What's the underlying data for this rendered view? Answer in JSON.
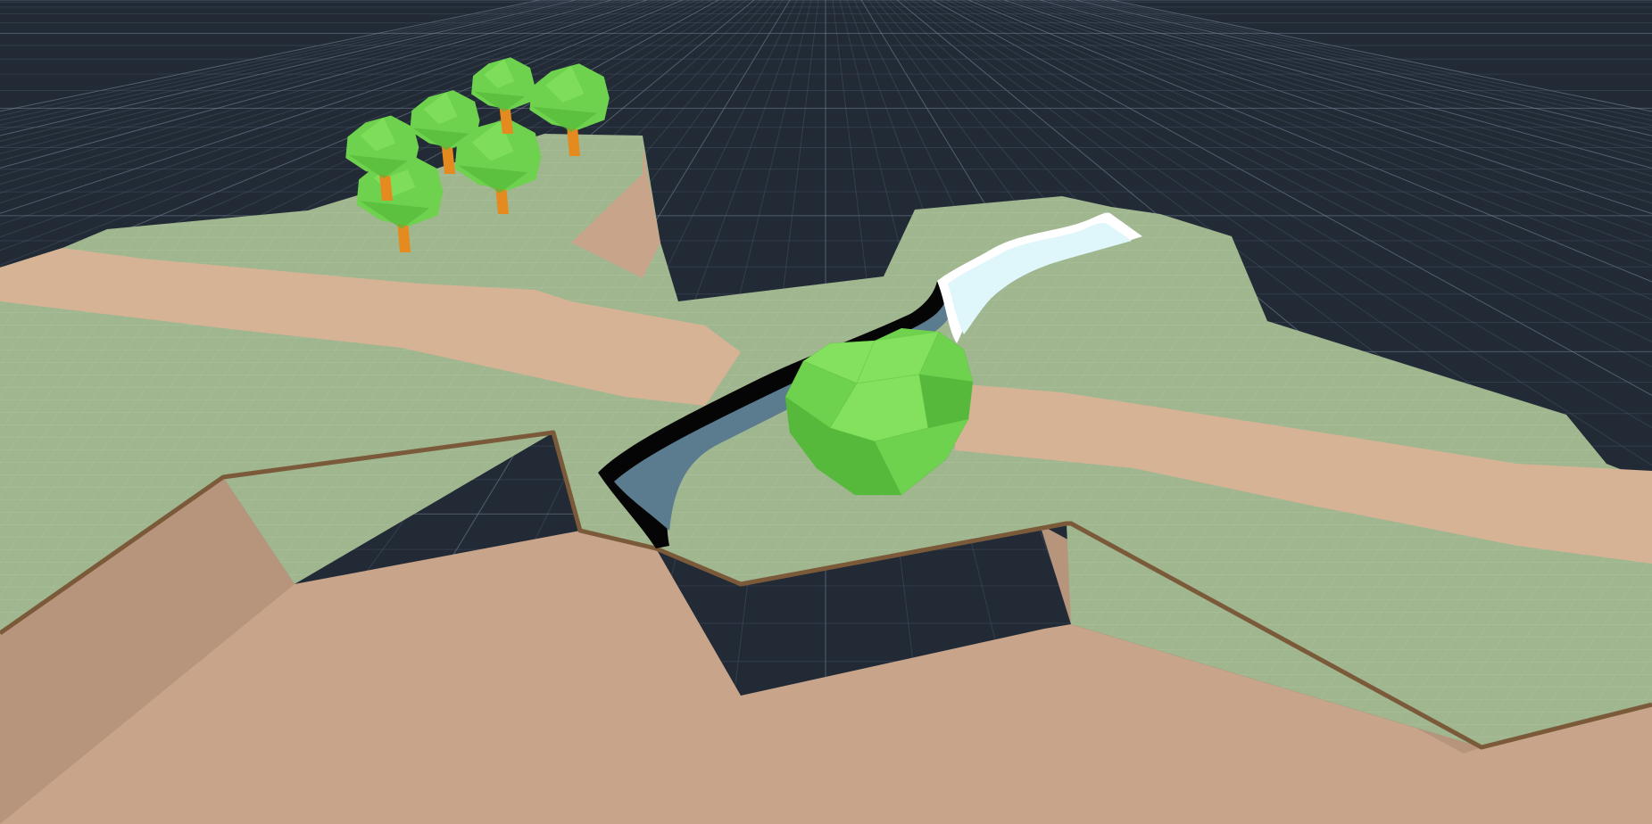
{
  "scene": {
    "kind": "3d-editor-viewport",
    "objects": [
      {
        "name": "terrain-tile",
        "material": "grass-and-sand"
      },
      {
        "name": "river",
        "material": "water"
      },
      {
        "name": "tree-cluster",
        "count": 6
      },
      {
        "name": "large-bush",
        "count": 1
      }
    ]
  },
  "colors": {
    "background": "#222a36",
    "grid_line": "#4c5868",
    "grid_line_bright": "#7c8a9c",
    "grass": "#9fb68f",
    "grass_dark": "#94ad85",
    "sand_top": "#d7b396",
    "cliff": "#c7a48a",
    "cliff_shadow": "#b6957c",
    "cliff_edge": "#7b5a3a",
    "water": "#5b7c8e",
    "water_light": "#dff6fb",
    "water_foam": "#ffffff",
    "channel_black": "#050505",
    "foliage": "#6fd24e",
    "foliage_light": "#83e15d",
    "foliage_dark": "#56b93b",
    "trunk": "#e48a1f"
  }
}
